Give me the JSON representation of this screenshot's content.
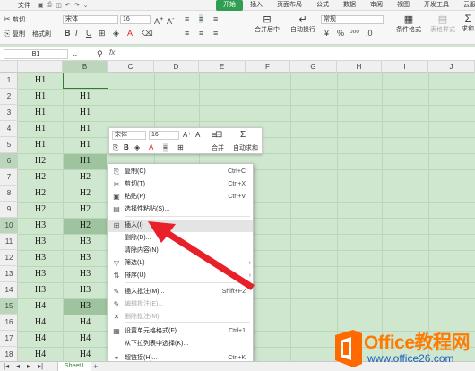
{
  "menubar": {
    "file_label": "文件",
    "tabs": [
      "开始",
      "插入",
      "页面布局",
      "公式",
      "数据",
      "审阅",
      "视图",
      "开发工具",
      "云服务"
    ]
  },
  "ribbon": {
    "cut": "剪切",
    "copy": "复制",
    "format_painter": "格式刷",
    "paste": "粘贴",
    "font_name": "宋体",
    "font_size": "16",
    "number_format": "常规",
    "merge_center": "合并居中",
    "wrap_text": "自动换行",
    "cond_format": "条件格式",
    "table_style": "表格样式",
    "sum": "求和"
  },
  "formula_bar": {
    "name_box": "B1",
    "fx": "fx"
  },
  "columns": [
    "B",
    "C",
    "D",
    "E",
    "F",
    "G",
    "H",
    "I",
    "J"
  ],
  "first_col_placeholder": "",
  "rows": [
    {
      "n": "1",
      "a": "H1",
      "b": ""
    },
    {
      "n": "2",
      "a": "H1",
      "b": "H1"
    },
    {
      "n": "3",
      "a": "H1",
      "b": "H1"
    },
    {
      "n": "4",
      "a": "H1",
      "b": "H1"
    },
    {
      "n": "5",
      "a": "H1",
      "b": "H1"
    },
    {
      "n": "6",
      "a": "H2",
      "b": "H1"
    },
    {
      "n": "7",
      "a": "H2",
      "b": "H2"
    },
    {
      "n": "8",
      "a": "H2",
      "b": "H2"
    },
    {
      "n": "9",
      "a": "H2",
      "b": "H2"
    },
    {
      "n": "10",
      "a": "H3",
      "b": "H2"
    },
    {
      "n": "11",
      "a": "H3",
      "b": "H3"
    },
    {
      "n": "12",
      "a": "H3",
      "b": "H3"
    },
    {
      "n": "13",
      "a": "H3",
      "b": "H3"
    },
    {
      "n": "14",
      "a": "H3",
      "b": "H3"
    },
    {
      "n": "15",
      "a": "H4",
      "b": "H3"
    },
    {
      "n": "16",
      "a": "H4",
      "b": "H4"
    },
    {
      "n": "17",
      "a": "H4",
      "b": "H4"
    },
    {
      "n": "18",
      "a": "H4",
      "b": "H4"
    }
  ],
  "mini_toolbar": {
    "font_name": "宋体",
    "font_size": "16",
    "merge": "合并",
    "autosum": "自动求和"
  },
  "context_menu": {
    "items": [
      {
        "icon": "⎘",
        "label": "复制(C)",
        "shortcut": "Ctrl+C"
      },
      {
        "icon": "✂",
        "label": "剪切(T)",
        "shortcut": "Ctrl+X"
      },
      {
        "icon": "▣",
        "label": "粘贴(P)",
        "shortcut": "Ctrl+V"
      },
      {
        "icon": "▤",
        "label": "选择性粘贴(S)...",
        "shortcut": ""
      },
      {
        "icon": "⊞",
        "label": "插入(I)",
        "shortcut": ""
      },
      {
        "icon": "",
        "label": "删除(D)...",
        "shortcut": ""
      },
      {
        "icon": "",
        "label": "清除内容(N)",
        "shortcut": ""
      },
      {
        "icon": "▽",
        "label": "筛选(L)",
        "shortcut": ""
      },
      {
        "icon": "⇅",
        "label": "排序(U)",
        "shortcut": ""
      },
      {
        "icon": "✎",
        "label": "插入批注(M)...",
        "shortcut": "Shift+F2"
      },
      {
        "icon": "✎",
        "label": "编辑批注(E)...",
        "shortcut": ""
      },
      {
        "icon": "✕",
        "label": "删除批注(M)",
        "shortcut": ""
      },
      {
        "icon": "▦",
        "label": "设置单元格格式(F)...",
        "shortcut": "Ctrl+1"
      },
      {
        "icon": "",
        "label": "从下拉列表中选择(K)...",
        "shortcut": ""
      },
      {
        "icon": "⚭",
        "label": "超链接(H)...",
        "shortcut": "Ctrl+K"
      }
    ]
  },
  "sheet": {
    "tab": "Sheet1",
    "add": "+"
  },
  "watermark": {
    "line1": "Office教程网",
    "line2": "www.office26.com"
  },
  "colors": {
    "accent": "#2f9e52",
    "sheet_bg": "#cfe6cf",
    "selection": "#9fc39f",
    "arrow": "#e8202a",
    "wm_orange": "#ff7a00",
    "wm_blue": "#2060c0"
  }
}
